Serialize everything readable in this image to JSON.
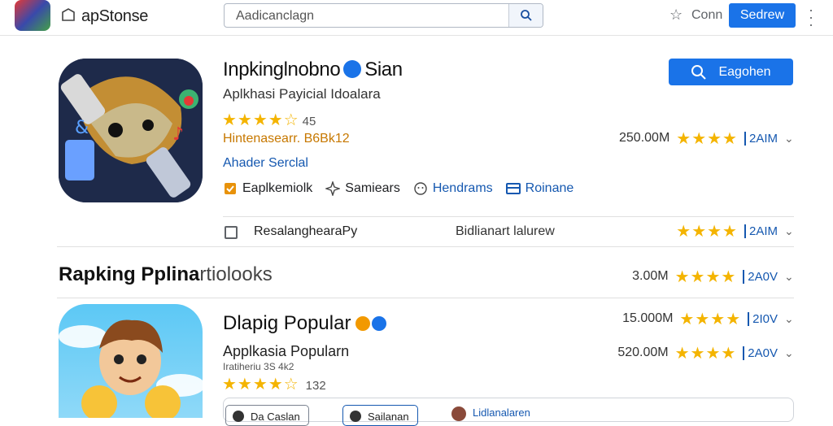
{
  "header": {
    "brand": "apStonse",
    "search_placeholder": "Aadicanclagn",
    "com_label": "Conn",
    "action_button": "Sedrew"
  },
  "featured": {
    "title": "Inpkinglnobno",
    "title_suffix": "Sian",
    "subtitle": "Aplkhasi Payicial Idoalara",
    "rating_count": "45",
    "meta": "Hintenasearr. B6Bk12",
    "link": "Ahader Serclal",
    "install_label": "Eagohen",
    "tags": [
      "Eaplkemiolk",
      "Samiears",
      "Hendrams",
      "Roinane"
    ],
    "stat_size": "250.00M",
    "stat_count": "2AIM"
  },
  "review_row": {
    "label": "ResalanghearaPy",
    "middle": "Bidlianart lalurew",
    "stat_count": "2AIM"
  },
  "section": {
    "title": "Rapking Pplina",
    "title_faint": "rtiolooks",
    "stat_size": "3.00M",
    "stat_count": "2A0V"
  },
  "popular": {
    "title": "Dlapig Popular",
    "subtitle": "Applkasia Popularn",
    "meta": "Iratiheriu 3S 4k2",
    "rating_count": "132",
    "stats": [
      {
        "size": "15.000M",
        "count": "2I0V"
      },
      {
        "size": "520.00M",
        "count": "2A0V"
      }
    ],
    "chips": [
      "Da Caslan",
      "Sailanan",
      "Lidlanalaren"
    ]
  },
  "colors": {
    "accent": "#1a73e8",
    "star": "#f4b400",
    "link": "#1558b0",
    "meta": "#c77800"
  }
}
